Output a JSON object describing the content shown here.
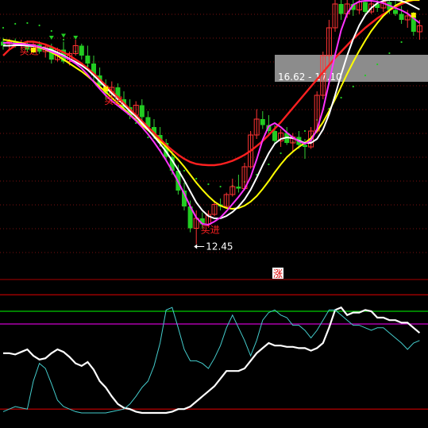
{
  "chart_data": [
    {
      "type": "candlestick",
      "panel": "price",
      "ylim": [
        11.8,
        18.6
      ],
      "annotations": {
        "low_marker": "12.45",
        "range_box_text": "16.62 - 17.10",
        "buy_signals": [
          "买进",
          "买进",
          "买进"
        ]
      },
      "candles": [
        {
          "o": 17.55,
          "h": 17.65,
          "l": 17.35,
          "c": 17.45,
          "dir": "down"
        },
        {
          "o": 17.5,
          "h": 17.62,
          "l": 17.38,
          "c": 17.55,
          "dir": "up"
        },
        {
          "o": 17.55,
          "h": 17.63,
          "l": 17.4,
          "c": 17.45,
          "dir": "down"
        },
        {
          "o": 17.45,
          "h": 17.6,
          "l": 17.35,
          "c": 17.5,
          "dir": "up"
        },
        {
          "o": 17.5,
          "h": 17.58,
          "l": 17.3,
          "c": 17.35,
          "dir": "down"
        },
        {
          "o": 17.35,
          "h": 17.55,
          "l": 17.28,
          "c": 17.48,
          "dir": "up"
        },
        {
          "o": 17.48,
          "h": 17.56,
          "l": 17.25,
          "c": 17.3,
          "dir": "down"
        },
        {
          "o": 17.3,
          "h": 17.5,
          "l": 17.15,
          "c": 17.42,
          "dir": "up"
        },
        {
          "o": 17.42,
          "h": 17.5,
          "l": 17.0,
          "c": 17.1,
          "dir": "down"
        },
        {
          "o": 17.1,
          "h": 17.4,
          "l": 17.05,
          "c": 17.35,
          "dir": "up"
        },
        {
          "o": 17.35,
          "h": 17.55,
          "l": 17.0,
          "c": 17.05,
          "dir": "down"
        },
        {
          "o": 17.05,
          "h": 17.3,
          "l": 16.95,
          "c": 17.25,
          "dir": "up"
        },
        {
          "o": 17.25,
          "h": 17.6,
          "l": 17.2,
          "c": 17.45,
          "dir": "up"
        },
        {
          "o": 17.45,
          "h": 17.5,
          "l": 17.1,
          "c": 17.2,
          "dir": "down"
        },
        {
          "o": 17.2,
          "h": 17.45,
          "l": 16.9,
          "c": 17.0,
          "dir": "down"
        },
        {
          "o": 17.0,
          "h": 17.2,
          "l": 16.55,
          "c": 16.7,
          "dir": "down"
        },
        {
          "o": 16.7,
          "h": 16.9,
          "l": 16.35,
          "c": 16.45,
          "dir": "down"
        },
        {
          "o": 16.45,
          "h": 16.6,
          "l": 16.1,
          "c": 16.25,
          "dir": "down"
        },
        {
          "o": 16.25,
          "h": 16.55,
          "l": 16.0,
          "c": 16.4,
          "dir": "up"
        },
        {
          "o": 16.4,
          "h": 16.5,
          "l": 16.0,
          "c": 16.1,
          "dir": "down"
        },
        {
          "o": 16.1,
          "h": 16.3,
          "l": 15.8,
          "c": 15.9,
          "dir": "down"
        },
        {
          "o": 15.9,
          "h": 16.1,
          "l": 15.6,
          "c": 15.7,
          "dir": "down"
        },
        {
          "o": 15.7,
          "h": 16.05,
          "l": 15.6,
          "c": 15.95,
          "dir": "up"
        },
        {
          "o": 15.95,
          "h": 16.1,
          "l": 15.55,
          "c": 15.65,
          "dir": "down"
        },
        {
          "o": 15.65,
          "h": 15.8,
          "l": 15.3,
          "c": 15.4,
          "dir": "down"
        },
        {
          "o": 15.4,
          "h": 15.6,
          "l": 15.1,
          "c": 15.2,
          "dir": "down"
        },
        {
          "o": 15.2,
          "h": 15.4,
          "l": 14.9,
          "c": 15.0,
          "dir": "down"
        },
        {
          "o": 15.0,
          "h": 15.1,
          "l": 14.55,
          "c": 14.65,
          "dir": "down"
        },
        {
          "o": 14.65,
          "h": 14.8,
          "l": 14.2,
          "c": 14.3,
          "dir": "down"
        },
        {
          "o": 14.3,
          "h": 14.45,
          "l": 13.7,
          "c": 13.8,
          "dir": "down"
        },
        {
          "o": 13.8,
          "h": 14.0,
          "l": 13.3,
          "c": 13.4,
          "dir": "down"
        },
        {
          "o": 13.4,
          "h": 13.55,
          "l": 12.75,
          "c": 12.85,
          "dir": "down"
        },
        {
          "o": 12.85,
          "h": 13.3,
          "l": 12.45,
          "c": 13.1,
          "dir": "up"
        },
        {
          "o": 13.1,
          "h": 13.25,
          "l": 12.85,
          "c": 12.95,
          "dir": "down"
        },
        {
          "o": 12.95,
          "h": 13.3,
          "l": 12.9,
          "c": 13.2,
          "dir": "up"
        },
        {
          "o": 13.2,
          "h": 13.55,
          "l": 13.15,
          "c": 13.45,
          "dir": "up"
        },
        {
          "o": 13.45,
          "h": 13.6,
          "l": 13.3,
          "c": 13.4,
          "dir": "down"
        },
        {
          "o": 13.4,
          "h": 13.75,
          "l": 13.35,
          "c": 13.7,
          "dir": "up"
        },
        {
          "o": 13.7,
          "h": 14.1,
          "l": 13.65,
          "c": 13.9,
          "dir": "up"
        },
        {
          "o": 13.9,
          "h": 14.2,
          "l": 13.75,
          "c": 13.85,
          "dir": "down"
        },
        {
          "o": 13.85,
          "h": 14.5,
          "l": 13.8,
          "c": 14.4,
          "dir": "up"
        },
        {
          "o": 14.4,
          "h": 15.3,
          "l": 14.35,
          "c": 15.2,
          "dir": "up"
        },
        {
          "o": 15.2,
          "h": 15.85,
          "l": 15.1,
          "c": 15.6,
          "dir": "up"
        },
        {
          "o": 15.6,
          "h": 15.8,
          "l": 15.35,
          "c": 15.45,
          "dir": "down"
        },
        {
          "o": 15.45,
          "h": 15.7,
          "l": 15.2,
          "c": 15.3,
          "dir": "down"
        },
        {
          "o": 15.3,
          "h": 15.45,
          "l": 14.95,
          "c": 15.05,
          "dir": "down"
        },
        {
          "o": 15.05,
          "h": 15.35,
          "l": 14.9,
          "c": 15.25,
          "dir": "up"
        },
        {
          "o": 15.25,
          "h": 15.4,
          "l": 14.95,
          "c": 15.0,
          "dir": "down"
        },
        {
          "o": 15.0,
          "h": 15.25,
          "l": 14.8,
          "c": 15.15,
          "dir": "up"
        },
        {
          "o": 15.15,
          "h": 15.3,
          "l": 14.85,
          "c": 14.95,
          "dir": "down"
        },
        {
          "o": 14.95,
          "h": 15.1,
          "l": 14.6,
          "c": 14.9,
          "dir": "down"
        },
        {
          "o": 14.9,
          "h": 15.4,
          "l": 14.85,
          "c": 15.3,
          "dir": "up"
        },
        {
          "o": 15.3,
          "h": 16.3,
          "l": 15.25,
          "c": 16.2,
          "dir": "up"
        },
        {
          "o": 16.2,
          "h": 17.3,
          "l": 16.1,
          "c": 17.2,
          "dir": "up"
        },
        {
          "o": 17.2,
          "h": 18.1,
          "l": 17.0,
          "c": 17.9,
          "dir": "up"
        },
        {
          "o": 17.9,
          "h": 18.6,
          "l": 17.8,
          "c": 18.5,
          "dir": "up"
        },
        {
          "o": 18.5,
          "h": 18.6,
          "l": 18.1,
          "c": 18.25,
          "dir": "down"
        },
        {
          "o": 18.25,
          "h": 18.6,
          "l": 18.15,
          "c": 18.5,
          "dir": "up"
        },
        {
          "o": 18.5,
          "h": 18.6,
          "l": 18.2,
          "c": 18.35,
          "dir": "down"
        },
        {
          "o": 18.35,
          "h": 18.6,
          "l": 18.25,
          "c": 18.55,
          "dir": "up"
        },
        {
          "o": 18.55,
          "h": 18.6,
          "l": 18.2,
          "c": 18.3,
          "dir": "down"
        },
        {
          "o": 18.3,
          "h": 18.6,
          "l": 18.25,
          "c": 18.5,
          "dir": "up"
        },
        {
          "o": 18.5,
          "h": 18.6,
          "l": 18.3,
          "c": 18.4,
          "dir": "down"
        },
        {
          "o": 18.4,
          "h": 18.6,
          "l": 18.3,
          "c": 18.55,
          "dir": "up"
        },
        {
          "o": 18.55,
          "h": 18.6,
          "l": 18.25,
          "c": 18.35,
          "dir": "down"
        },
        {
          "o": 18.35,
          "h": 18.6,
          "l": 18.2,
          "c": 18.25,
          "dir": "down"
        },
        {
          "o": 18.25,
          "h": 18.45,
          "l": 18.0,
          "c": 18.1,
          "dir": "down"
        },
        {
          "o": 18.1,
          "h": 18.35,
          "l": 17.9,
          "c": 18.2,
          "dir": "up"
        },
        {
          "o": 18.2,
          "h": 18.3,
          "l": 17.7,
          "c": 17.8,
          "dir": "down"
        },
        {
          "o": 17.8,
          "h": 18.1,
          "l": 17.6,
          "c": 17.95,
          "dir": "up"
        }
      ],
      "overlay_lines": [
        {
          "name": "",
          "color": "#ff2020",
          "values": [
            17.2,
            17.35,
            17.45,
            17.5,
            17.55,
            17.55,
            17.52,
            17.48,
            17.42,
            17.35,
            17.28,
            17.2,
            17.1,
            17.0,
            16.88,
            16.75,
            16.6,
            16.45,
            16.3,
            16.15,
            16.0,
            15.85,
            15.7,
            15.55,
            15.4,
            15.25,
            15.1,
            14.95,
            14.82,
            14.7,
            14.6,
            14.52,
            14.47,
            14.45,
            14.44,
            14.44,
            14.46,
            14.5,
            14.55,
            14.62,
            14.7,
            14.8,
            14.92,
            15.05,
            15.2,
            15.36,
            15.52,
            15.7,
            15.88,
            16.06,
            16.24,
            16.42,
            16.6,
            16.78,
            16.96,
            17.14,
            17.3,
            17.46,
            17.62,
            17.76,
            17.9,
            18.02,
            18.14,
            18.24,
            18.34,
            18.42,
            18.5,
            18.56,
            18.6,
            18.6
          ]
        },
        {
          "name": "",
          "color": "#ffff00",
          "values": [
            17.6,
            17.58,
            17.55,
            17.52,
            17.48,
            17.45,
            17.4,
            17.35,
            17.28,
            17.2,
            17.1,
            17.0,
            16.9,
            16.8,
            16.68,
            16.55,
            16.42,
            16.28,
            16.14,
            16.0,
            15.86,
            15.72,
            15.58,
            15.45,
            15.32,
            15.18,
            15.04,
            14.9,
            14.74,
            14.58,
            14.4,
            14.2,
            14.0,
            13.82,
            13.66,
            13.52,
            13.42,
            13.36,
            13.34,
            13.36,
            13.42,
            13.52,
            13.66,
            13.84,
            14.04,
            14.26,
            14.46,
            14.64,
            14.78,
            14.9,
            15.0,
            15.12,
            15.3,
            15.52,
            15.8,
            16.1,
            16.42,
            16.74,
            17.04,
            17.32,
            17.58,
            17.82,
            18.02,
            18.2,
            18.34,
            18.46,
            18.54,
            18.58,
            18.6,
            18.6
          ]
        },
        {
          "name": "",
          "color": "#ffffff",
          "values": [
            17.45,
            17.45,
            17.46,
            17.46,
            17.45,
            17.44,
            17.42,
            17.38,
            17.34,
            17.28,
            17.2,
            17.12,
            17.04,
            16.95,
            16.84,
            16.7,
            16.55,
            16.4,
            16.25,
            16.1,
            15.95,
            15.8,
            15.66,
            15.5,
            15.34,
            15.16,
            14.98,
            14.78,
            14.56,
            14.32,
            14.06,
            13.78,
            13.5,
            13.3,
            13.16,
            13.1,
            13.1,
            13.16,
            13.26,
            13.4,
            13.58,
            13.82,
            14.12,
            14.44,
            14.74,
            14.98,
            15.1,
            15.14,
            15.12,
            15.06,
            15.0,
            15.0,
            15.1,
            15.34,
            15.72,
            16.2,
            16.72,
            17.2,
            17.62,
            17.96,
            18.22,
            18.4,
            18.52,
            18.58,
            18.6,
            18.6,
            18.58,
            18.52,
            18.44,
            18.36
          ]
        },
        {
          "name": "",
          "color": "#ff33ff",
          "values": [
            17.52,
            17.52,
            17.5,
            17.5,
            17.48,
            17.46,
            17.42,
            17.36,
            17.3,
            17.24,
            17.18,
            17.1,
            17.0,
            16.88,
            16.72,
            16.54,
            16.36,
            16.2,
            16.06,
            15.94,
            15.82,
            15.7,
            15.56,
            15.4,
            15.22,
            15.02,
            14.8,
            14.56,
            14.3,
            14.02,
            13.72,
            13.4,
            13.12,
            12.96,
            12.94,
            13.02,
            13.12,
            13.28,
            13.46,
            13.64,
            13.84,
            14.14,
            14.58,
            15.08,
            15.42,
            15.5,
            15.4,
            15.26,
            15.14,
            15.04,
            14.98,
            15.06,
            15.34,
            15.84,
            16.52,
            17.22,
            17.84,
            18.26,
            18.48,
            18.56,
            18.58,
            18.58,
            18.56,
            18.52,
            18.46,
            18.4,
            18.34,
            18.26,
            18.14,
            18.02
          ]
        }
      ],
      "dotted_line": {
        "name": "",
        "color": "#22cc22",
        "values": [
          17.9,
          17.95,
          18.0,
          18.02,
          18.02,
          18.0,
          17.96,
          17.9,
          17.82,
          17.72,
          17.6,
          17.46,
          17.3,
          17.12,
          16.94,
          16.76,
          16.58,
          16.4,
          16.22,
          16.04,
          15.86,
          15.68,
          15.5,
          15.32,
          15.14,
          14.98,
          14.82,
          14.68,
          14.54,
          14.42,
          14.3,
          14.2,
          14.1,
          14.02,
          13.96,
          13.92,
          13.9,
          13.9,
          13.92,
          13.96,
          14.02,
          14.1,
          14.2,
          14.32,
          14.46,
          14.6,
          14.74,
          14.88,
          15.02,
          15.16,
          15.3,
          15.44,
          15.58,
          15.72,
          15.86,
          16.0,
          16.14,
          16.28,
          16.42,
          16.56,
          16.7,
          16.84,
          16.98,
          17.12,
          17.26,
          17.4,
          17.54,
          17.68,
          17.82,
          17.96
        ]
      }
    },
    {
      "type": "line",
      "panel": "indicator",
      "ylim": [
        0,
        100
      ],
      "reference_lines": [
        {
          "value": 98,
          "color": "#cc0000"
        },
        {
          "value": 85,
          "color": "#00cc00"
        },
        {
          "value": 75,
          "color": "#cc00cc"
        },
        {
          "value": 8,
          "color": "#cc0000"
        }
      ],
      "annotations": {
        "badge": "涨"
      },
      "series": [
        {
          "name": "",
          "color": "#ffffff",
          "values": [
            52,
            52,
            51,
            53,
            55,
            50,
            47,
            48,
            52,
            55,
            53,
            49,
            44,
            42,
            45,
            39,
            30,
            25,
            18,
            12,
            9,
            8,
            6,
            5,
            5,
            5,
            5,
            5,
            6,
            8,
            8,
            10,
            14,
            18,
            22,
            26,
            32,
            38,
            38,
            38,
            40,
            46,
            52,
            56,
            60,
            58,
            58,
            57,
            57,
            56,
            56,
            54,
            56,
            60,
            72,
            86,
            88,
            82,
            84,
            84,
            86,
            85,
            80,
            80,
            78,
            78,
            76,
            76,
            72,
            68
          ]
        },
        {
          "name": "",
          "color": "#44cccc",
          "values": [
            6,
            8,
            10,
            9,
            8,
            30,
            44,
            40,
            28,
            15,
            10,
            8,
            6,
            5,
            5,
            5,
            5,
            5,
            6,
            7,
            8,
            12,
            18,
            25,
            30,
            42,
            60,
            86,
            88,
            72,
            55,
            46,
            46,
            44,
            40,
            48,
            58,
            72,
            82,
            72,
            62,
            50,
            62,
            78,
            84,
            86,
            82,
            80,
            74,
            74,
            70,
            64,
            70,
            78,
            86,
            86,
            82,
            78,
            74,
            74,
            72,
            70,
            72,
            72,
            68,
            64,
            60,
            55,
            60,
            62
          ]
        }
      ]
    }
  ]
}
